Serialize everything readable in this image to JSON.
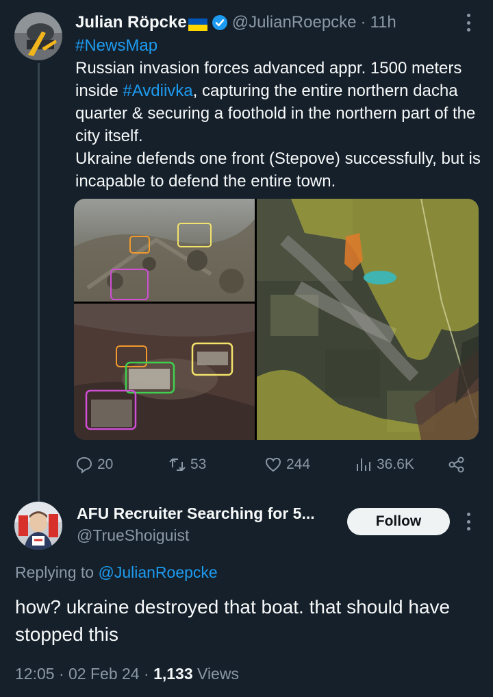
{
  "original_tweet": {
    "author_name": "Julian Röpcke",
    "handle": "@JulianRoepcke",
    "separator": "·",
    "time_ago": "11h",
    "hashtag_line": "#NewsMap",
    "body_part1": "Russian invasion forces advanced appr. 1500 meters inside ",
    "body_hashtag": "#Avdiivka",
    "body_part2": ", capturing the entire northern dacha quarter & securing a foothold in the northern part of the city itself.",
    "body_para2": "Ukraine defends one front (Stepove) successfully, but is incapable to defend the entire town.",
    "stats": {
      "replies": "20",
      "retweets": "53",
      "likes": "244",
      "views": "36.6K"
    }
  },
  "reply_tweet": {
    "author_name": "AFU Recruiter Searching for 5...",
    "handle": "@TrueShoiguist",
    "follow_label": "Follow",
    "replying_prefix": "Replying to ",
    "replying_to": "@JulianRoepcke",
    "body": "how? ukraine destroyed that boat. that should have stopped this",
    "time": "12:05",
    "separator1": "·",
    "date": "02 Feb 24",
    "separator2": "·",
    "views_count": "1,133",
    "views_label": " Views"
  },
  "colors": {
    "background": "#15202b",
    "link": "#1d9bf0",
    "muted": "#8b98a5",
    "verified": "#1d9bf0"
  }
}
